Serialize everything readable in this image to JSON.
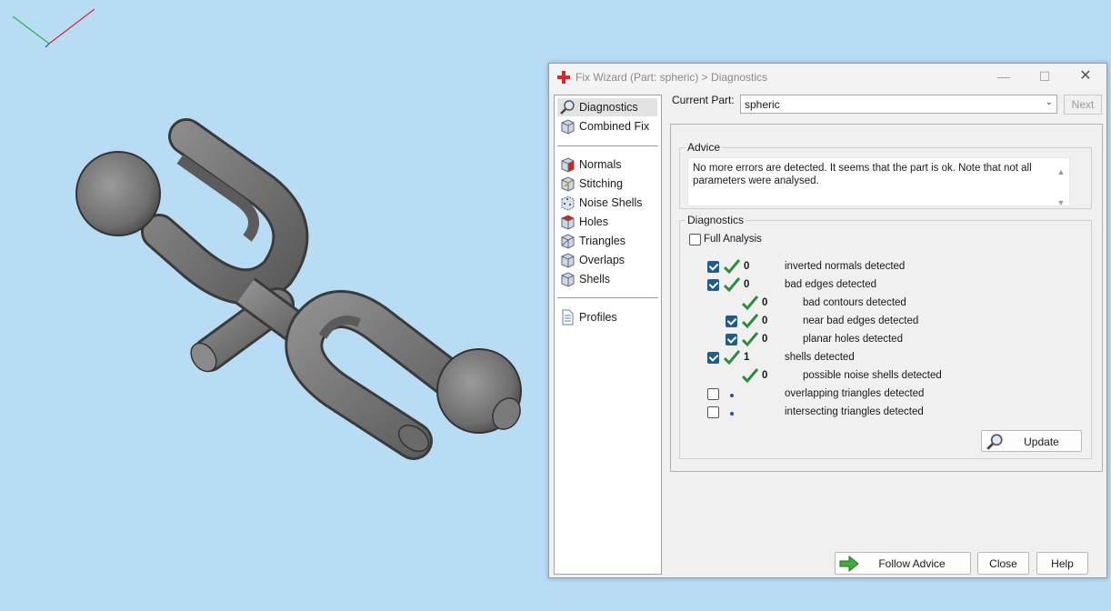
{
  "window": {
    "title": "Fix Wizard (Part: spheric) > Diagnostics",
    "controls": {
      "minimize": "—",
      "maximize": "☐",
      "close": "✕"
    }
  },
  "nav": {
    "items": [
      {
        "label": "Diagnostics",
        "icon": "magnifier-icon",
        "selected": true
      },
      {
        "label": "Combined Fix",
        "icon": "cube-icon"
      },
      {
        "label": "Normals",
        "icon": "cube-red-face-icon"
      },
      {
        "label": "Stitching",
        "icon": "cube-icon"
      },
      {
        "label": "Noise Shells",
        "icon": "cube-dotted-icon"
      },
      {
        "label": "Holes",
        "icon": "cube-red-face-icon"
      },
      {
        "label": "Triangles",
        "icon": "cube-icon"
      },
      {
        "label": "Overlaps",
        "icon": "cube-icon"
      },
      {
        "label": "Shells",
        "icon": "cube-icon"
      },
      {
        "label": "Profiles",
        "icon": "document-icon"
      }
    ]
  },
  "current_part": {
    "label": "Current Part:",
    "value": "spheric",
    "next_label": "Next"
  },
  "advice": {
    "title": "Advice",
    "text": "No more errors are detected. It seems that the part is ok. Note that not all parameters were analysed."
  },
  "diagnostics": {
    "title": "Diagnostics",
    "full_analysis": {
      "label": "Full Analysis",
      "checked": false
    },
    "rows": [
      {
        "checkbox": true,
        "checked": true,
        "status": "ok",
        "count": "0",
        "label": "inverted normals detected",
        "indent": 0
      },
      {
        "checkbox": true,
        "checked": true,
        "status": "ok",
        "count": "0",
        "label": "bad edges detected",
        "indent": 0
      },
      {
        "checkbox": false,
        "checked": false,
        "status": "ok",
        "count": "0",
        "label": "bad contours detected",
        "indent": 1
      },
      {
        "checkbox": true,
        "checked": true,
        "status": "ok",
        "count": "0",
        "label": "near bad edges detected",
        "indent": 1
      },
      {
        "checkbox": true,
        "checked": true,
        "status": "ok",
        "count": "0",
        "label": "planar holes detected",
        "indent": 1
      },
      {
        "checkbox": true,
        "checked": true,
        "status": "ok",
        "count": "1",
        "label": "shells detected",
        "indent": 0
      },
      {
        "checkbox": false,
        "checked": false,
        "status": "ok",
        "count": "0",
        "label": "possible noise shells detected",
        "indent": 1
      },
      {
        "checkbox": true,
        "checked": false,
        "status": "pending",
        "count": "",
        "label": "overlapping triangles detected",
        "indent": 0
      },
      {
        "checkbox": true,
        "checked": false,
        "status": "pending",
        "count": "",
        "label": "intersecting triangles detected",
        "indent": 0
      }
    ],
    "update_label": "Update"
  },
  "footer": {
    "follow_advice": "Follow Advice",
    "close": "Close",
    "help": "Help"
  },
  "colors": {
    "background": "#b9dcf5",
    "model": "#7c7c7c",
    "ok_tick": "#2e8b3a",
    "checkbox_on": "#1e5b8f",
    "pending_dot": "#2a45c8"
  }
}
